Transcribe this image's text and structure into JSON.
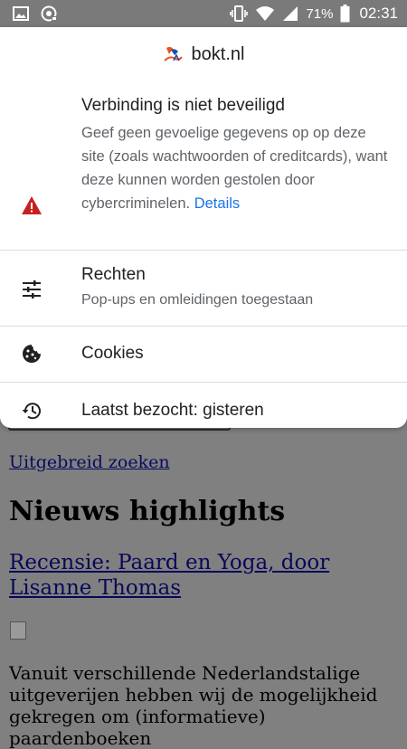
{
  "status_bar": {
    "battery_percent": "71%",
    "time": "02:31",
    "icons": [
      "image-icon",
      "camera-icon",
      "vibrate-icon",
      "wifi-icon",
      "signal-icon",
      "battery-icon"
    ]
  },
  "popup": {
    "site": "bokt.nl",
    "connection": {
      "title": "Verbinding is niet beveiligd",
      "description": "Geef geen gevoelige gegevens op op deze site (zoals wachtwoorden of creditcards), want deze kunnen worden gestolen door cybercriminelen.",
      "details_link": "Details",
      "icon": "warning-icon",
      "icon_color": "#c5221f"
    },
    "permissions": {
      "title": "Rechten",
      "subtitle": "Pop-ups en omleidingen toegestaan",
      "icon": "tune-icon"
    },
    "cookies": {
      "title": "Cookies",
      "icon": "cookie-icon"
    },
    "last_visited": {
      "title": "Laatst bezocht: gisteren",
      "icon": "history-icon"
    }
  },
  "page": {
    "advanced_search_link": "Uitgebreid zoeken",
    "news_heading": "Nieuws highlights",
    "article_link": "Recensie: Paard en Yoga, door Lisanne Thomas",
    "article_text": "Vanuit verschillende Nederlandstalige uitgeverijen hebben wij de mogelijkheid gekregen om (informatieve) paardenboeken"
  }
}
